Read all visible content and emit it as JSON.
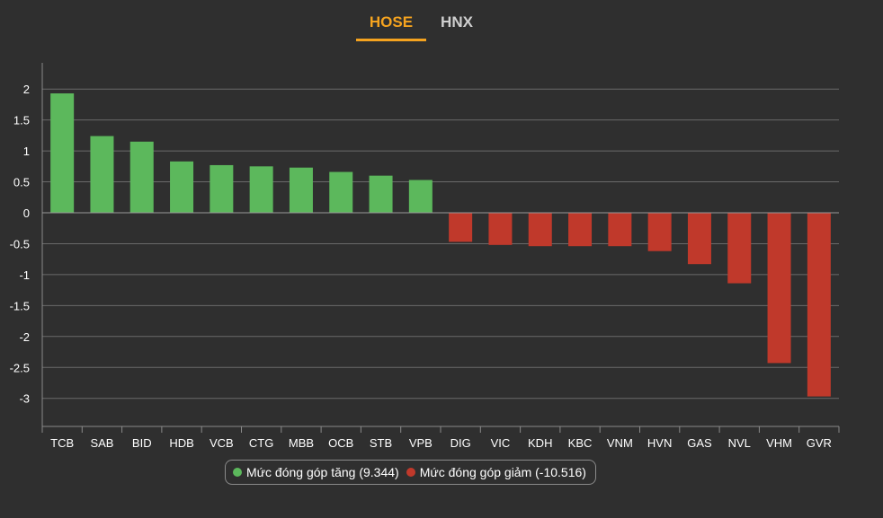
{
  "tabs": [
    {
      "label": "HOSE",
      "active": true
    },
    {
      "label": "HNX",
      "active": false
    }
  ],
  "colors": {
    "background": "#2f2f2f",
    "positive": "#5cb85c",
    "negative": "#c0392b",
    "active_tab": "#f5a31f",
    "grid": "#6a6a6a",
    "text": "#ffffff"
  },
  "legend": {
    "increase_label": "Mức đóng góp tăng (9.344)",
    "decrease_label": "Mức đóng góp giảm (-10.516)"
  },
  "chart_data": {
    "type": "bar",
    "categories": [
      "TCB",
      "SAB",
      "BID",
      "HDB",
      "VCB",
      "CTG",
      "MBB",
      "OCB",
      "STB",
      "VPB",
      "DIG",
      "VIC",
      "KDH",
      "KBC",
      "VNM",
      "HVN",
      "GAS",
      "NVL",
      "VHM",
      "GVR"
    ],
    "values": [
      1.93,
      1.24,
      1.15,
      0.83,
      0.77,
      0.75,
      0.73,
      0.66,
      0.6,
      0.53,
      -0.47,
      -0.52,
      -0.54,
      -0.54,
      -0.54,
      -0.62,
      -0.83,
      -1.14,
      -2.43,
      -2.97
    ],
    "yticks": [
      2,
      1.5,
      1,
      0.5,
      0,
      -0.5,
      -1,
      -1.5,
      -2,
      -2.5,
      -3
    ],
    "ytick_labels": [
      "2",
      "1.5",
      "1",
      "0.5",
      "0",
      "-0.5",
      "-1",
      "-1.5",
      "-2",
      "-2.5",
      "-3"
    ],
    "ylim": [
      -3.45,
      2.45
    ],
    "grid": true,
    "legend_position": "bottom"
  }
}
